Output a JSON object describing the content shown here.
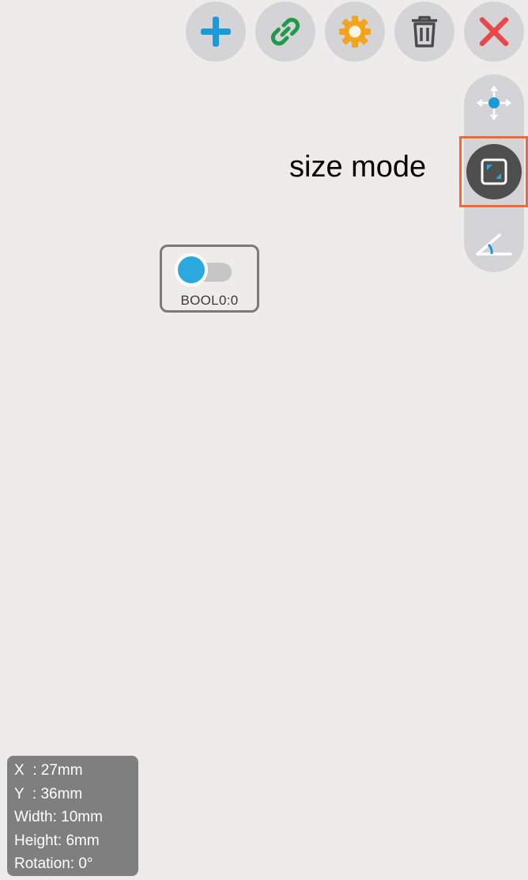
{
  "toolbar": {
    "buttons": [
      {
        "name": "add",
        "icon": "plus-icon",
        "color": "#1a9ad6"
      },
      {
        "name": "link",
        "icon": "link-icon",
        "color": "#1e9a4a"
      },
      {
        "name": "settings",
        "icon": "gear-icon",
        "color": "#f5a31c"
      },
      {
        "name": "delete",
        "icon": "trash-icon",
        "color": "#4a4a4a"
      },
      {
        "name": "close",
        "icon": "close-icon",
        "color": "#e8474d"
      }
    ]
  },
  "mode_panel": {
    "buttons": [
      {
        "name": "move-mode",
        "icon": "move-arrows-icon",
        "active": false
      },
      {
        "name": "size-mode",
        "icon": "resize-square-icon",
        "active": true
      },
      {
        "name": "rotate-mode",
        "icon": "angle-icon",
        "active": false
      }
    ],
    "highlight_color": "#f06a35",
    "callout_label": "size mode"
  },
  "widget": {
    "type": "toggle-switch",
    "label": "BOOL0:0",
    "state_on": true,
    "knob_color": "#2ba8de"
  },
  "info": {
    "x_label": "X  : ",
    "x_value": "27mm",
    "y_label": "Y  : ",
    "y_value": "36mm",
    "width_label": "Width: ",
    "width_value": "10mm",
    "height_label": "Height: ",
    "height_value": "6mm",
    "rotation_label": "Rotation: ",
    "rotation_value": "0°"
  }
}
